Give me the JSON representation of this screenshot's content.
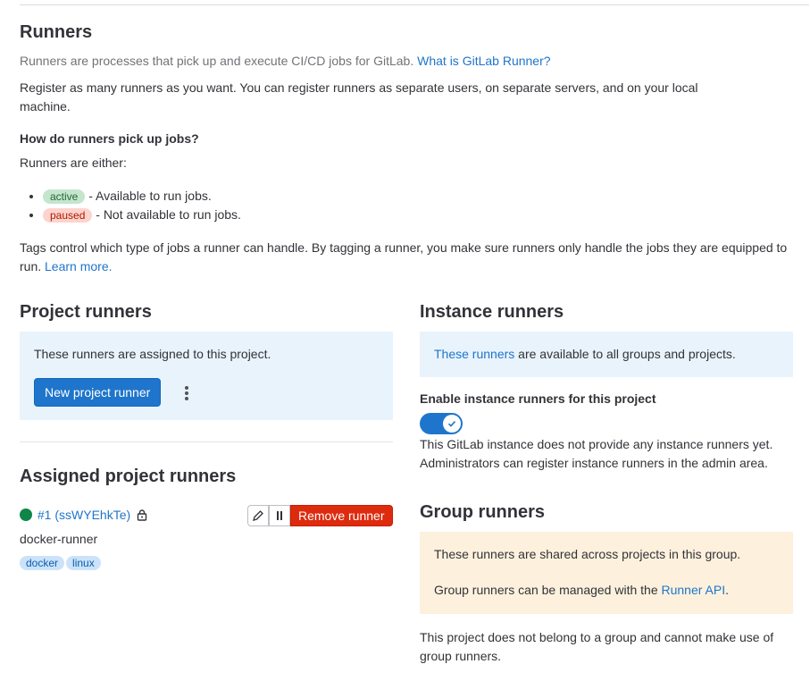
{
  "runners_section": {
    "title": "Runners",
    "intro": "Runners are processes that pick up and execute CI/CD jobs for GitLab.",
    "intro_link": "What is GitLab Runner?",
    "register_text": "Register as many runners as you want. You can register runners as separate users, on separate servers, and on your local machine.",
    "how_heading": "How do runners pick up jobs?",
    "either_text": "Runners are either:",
    "states": [
      {
        "badge": "active",
        "description": " - Available to run jobs."
      },
      {
        "badge": "paused",
        "description": " - Not available to run jobs."
      }
    ],
    "tags_text": "Tags control which type of jobs a runner can handle. By tagging a runner, you make sure runners only handle the jobs they are equipped to run.",
    "learn_more": "Learn more."
  },
  "project_runners": {
    "title": "Project runners",
    "box_text": "These runners are assigned to this project.",
    "new_button": "New project runner",
    "more_actions_icon": "vertical-ellipsis-icon"
  },
  "assigned": {
    "title": "Assigned project runners",
    "runner": {
      "status_color": "#108548",
      "id_link": "#1 (ssWYEhkTe)",
      "lock_icon": "lock-icon",
      "description": "docker-runner",
      "tags": [
        "docker",
        "linux"
      ],
      "edit_icon": "pencil-icon",
      "pause_icon": "pause-icon",
      "remove_button": "Remove runner"
    }
  },
  "instance_runners": {
    "title": "Instance runners",
    "box_link": "These runners",
    "box_text": " are available to all groups and projects.",
    "toggle_label": "Enable instance runners for this project",
    "toggle_on": true,
    "note": "This GitLab instance does not provide any instance runners yet. Administrators can register instance runners in the admin area."
  },
  "group_runners": {
    "title": "Group runners",
    "box_line1": "These runners are shared across projects in this group.",
    "box_line2": "Group runners can be managed with the ",
    "box_link": "Runner API",
    "box_line2_end": ".",
    "note": "This project does not belong to a group and cannot make use of group runners."
  },
  "colors": {
    "primary": "#1f75cb",
    "danger": "#dd2b0e",
    "success": "#108548",
    "info_bg": "#e9f3fc",
    "warning_bg": "#fdf1dd"
  }
}
